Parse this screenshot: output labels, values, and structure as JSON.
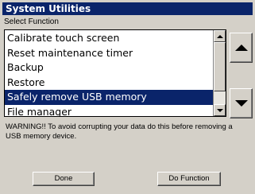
{
  "window": {
    "title": "System Utilities"
  },
  "select_label": "Select Function",
  "functions": [
    "Calibrate touch screen",
    "Reset maintenance timer",
    "Backup",
    "Restore",
    "Safely remove USB memory",
    "File manager"
  ],
  "selected_function": "Safely remove USB memory",
  "warning": "WARNING!! To avoid corrupting your data do this before removing a USB memory device.",
  "buttons": {
    "done": "Done",
    "do_function": "Do Function"
  },
  "colors": {
    "title_bg": "#0a246a",
    "selection_bg": "#0a246a",
    "dialog_bg": "#d4d0c8"
  },
  "icons": {
    "scroll_up": "triangle-up-icon",
    "scroll_down": "triangle-down-icon"
  }
}
